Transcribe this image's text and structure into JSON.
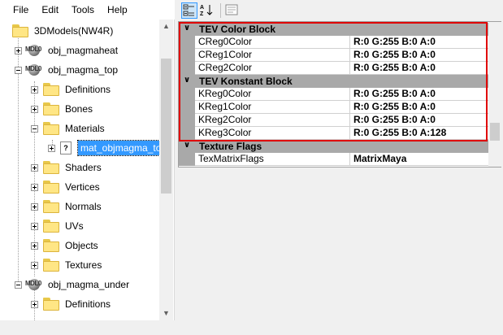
{
  "menu": {
    "items": [
      "File",
      "Edit",
      "Tools",
      "Help"
    ]
  },
  "tree": {
    "root": "3DModels(NW4R)",
    "model1": "obj_magmaheat",
    "model2": "obj_magma_top",
    "model2_children": [
      "Definitions",
      "Bones",
      "Materials",
      "Shaders",
      "Vertices",
      "Normals",
      "UVs",
      "Objects",
      "Textures"
    ],
    "material_item": "mat_objmagma_top",
    "model3": "obj_magma_under",
    "model3_children": [
      "Definitions"
    ],
    "mdl_icon_text": "MDL0",
    "unknown_icon_text": "?"
  },
  "toolbar": {
    "categorized_icon": "categorized-icon",
    "alpha_sort_icon": "alphabetical-sort-icon",
    "property_pages_icon": "property-pages-icon"
  },
  "grid": {
    "categories": [
      {
        "label": "TEV Color Block",
        "props": [
          {
            "name": "CReg0Color",
            "value": "R:0 G:255 B:0 A:0"
          },
          {
            "name": "CReg1Color",
            "value": "R:0 G:255 B:0 A:0"
          },
          {
            "name": "CReg2Color",
            "value": "R:0 G:255 B:0 A:0"
          }
        ]
      },
      {
        "label": "TEV Konstant Block",
        "props": [
          {
            "name": "KReg0Color",
            "value": "R:0 G:255 B:0 A:0"
          },
          {
            "name": "KReg1Color",
            "value": "R:0 G:255 B:0 A:0"
          },
          {
            "name": "KReg2Color",
            "value": "R:0 G:255 B:0 A:0"
          },
          {
            "name": "KReg3Color",
            "value": "R:0 G:255 B:0 A:128"
          }
        ]
      },
      {
        "label": "Texture Flags",
        "props": [
          {
            "name": "TexMatrixFlags",
            "value": "MatrixMaya"
          }
        ]
      }
    ]
  },
  "colors": {
    "selection": "#3399ff",
    "highlight_box": "#e00000",
    "category_bg": "#a9a9a9"
  }
}
